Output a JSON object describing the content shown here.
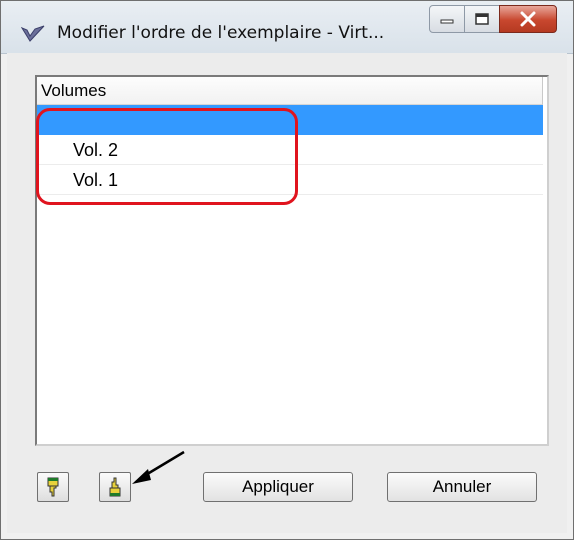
{
  "window": {
    "title": "Modifier l'ordre de l'exemplaire - Virt...",
    "icon": "checkmark-logo-icon",
    "controls": [
      "minimize-icon",
      "maximize-icon",
      "close-icon"
    ]
  },
  "list": {
    "column_header": "Volumes",
    "rows": [
      {
        "label": "",
        "selected": true
      },
      {
        "label": "Vol. 2",
        "selected": false
      },
      {
        "label": "Vol. 1",
        "selected": false
      }
    ]
  },
  "toolbar": {
    "move_down_icon": "hand-pointing-down-icon",
    "move_up_icon": "hand-pointing-up-icon",
    "apply_label": "Appliquer",
    "cancel_label": "Annuler"
  },
  "colors": {
    "selection": "#3399ff",
    "annotation": "#e0141e"
  }
}
